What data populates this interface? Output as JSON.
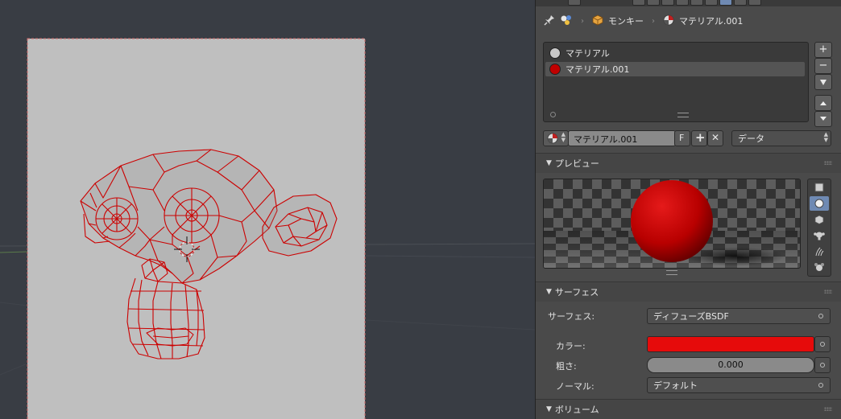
{
  "breadcrumb": {
    "object_name": "モンキー",
    "material_name": "マテリアル.001"
  },
  "material_slots": [
    {
      "name": "マテリアル",
      "swatch": "#c8c8c8",
      "selected": false
    },
    {
      "name": "マテリアル.001",
      "swatch": "#c00000",
      "selected": true
    }
  ],
  "slot_buttons": {
    "add": "+",
    "remove": "−"
  },
  "datablock": {
    "name": "マテリアル.001",
    "fake_user": "F",
    "new_label": "+",
    "unlink_label": "✕",
    "link_mode": "データ"
  },
  "sections": {
    "preview": "プレビュー",
    "surface": "サーフェス",
    "volume": "ボリューム"
  },
  "surface": {
    "surface_label": "サーフェス:",
    "surface_value": "ディフューズBSDF",
    "color_label": "カラー:",
    "color_value": "#e60b0b",
    "roughness_label": "粗さ:",
    "roughness_value": "0.000",
    "normal_label": "ノーマル:",
    "normal_value": "デフォルト"
  },
  "icons": [
    "pin-icon",
    "scene-icon",
    "object-icon",
    "material-icon",
    "plus-icon",
    "minus-icon",
    "specials-icon",
    "arrow-up-icon",
    "arrow-down-icon",
    "grip-icon",
    "preview-plane-icon",
    "preview-sphere-icon",
    "preview-cube-icon",
    "preview-monkey-icon",
    "preview-hair-icon",
    "preview-sphere-sky-icon",
    "cursor-3d-icon"
  ],
  "colors": {
    "accent": "#6f8ab3",
    "wire": "#d40000",
    "selected_row": "#545454"
  }
}
